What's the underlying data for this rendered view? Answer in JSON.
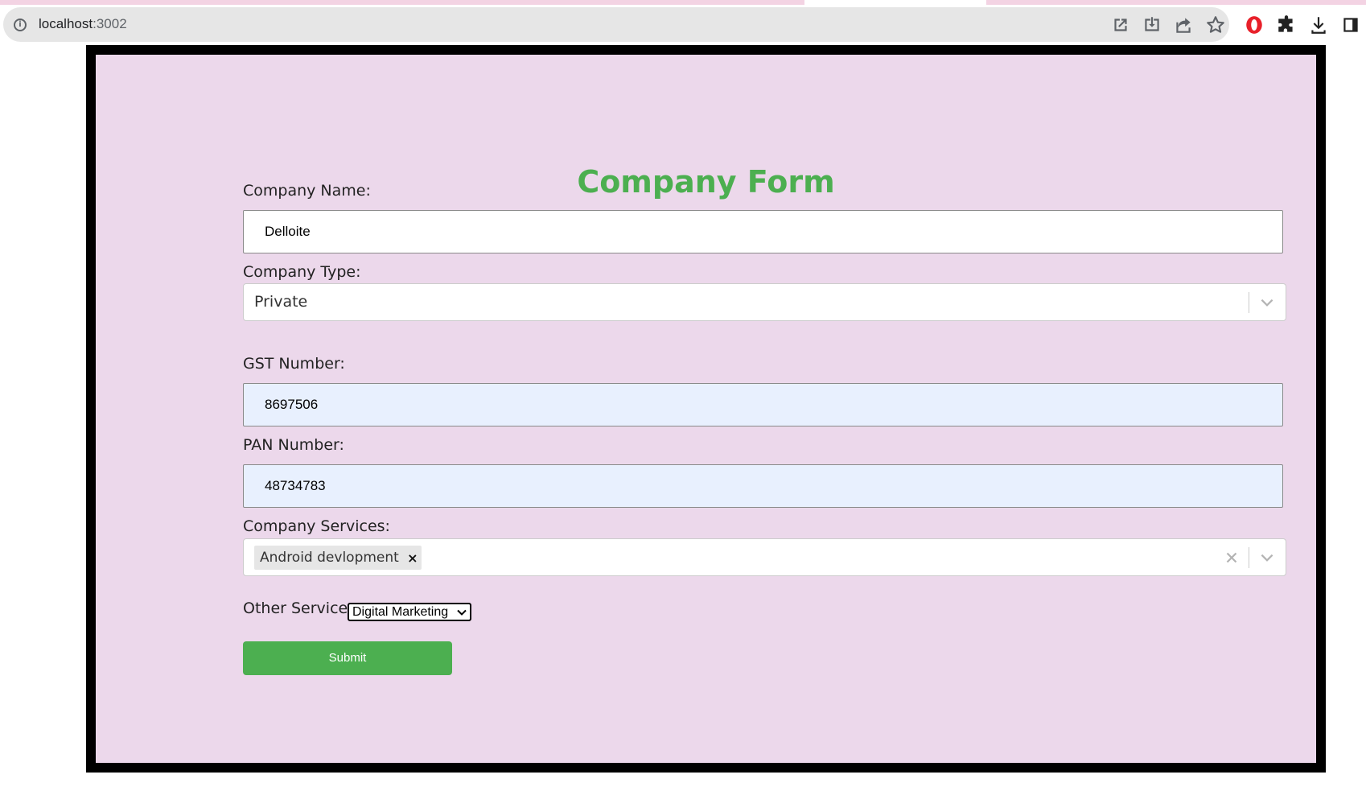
{
  "browser": {
    "url_host": "localhost",
    "url_port": ":3002"
  },
  "form": {
    "title": "Company Form",
    "company_name": {
      "label": "Company Name:",
      "value": "Delloite"
    },
    "company_type": {
      "label": "Company Type:",
      "value": "Private"
    },
    "gst_number": {
      "label": "GST Number:",
      "value": "8697506"
    },
    "pan_number": {
      "label": "PAN Number:",
      "value": "48734783"
    },
    "company_services": {
      "label": "Company Services:",
      "selected": [
        "Android devlopment"
      ],
      "remove_glyph": "×"
    },
    "other_services": {
      "label": "Other Services:",
      "value": "Digital Marketing"
    },
    "submit_label": "Submit"
  },
  "colors": {
    "title": "#4caf50",
    "background": "#ecd8eb",
    "frame": "#000000",
    "button": "#4caf50",
    "autofill": "#e8f0fe"
  },
  "icons": {
    "omnibox": [
      "info-icon",
      "open-in-new-icon",
      "install-icon",
      "share-icon",
      "star-icon"
    ],
    "extensions": [
      "opera-icon",
      "puzzle-icon",
      "download-icon",
      "sidebar-icon"
    ]
  }
}
